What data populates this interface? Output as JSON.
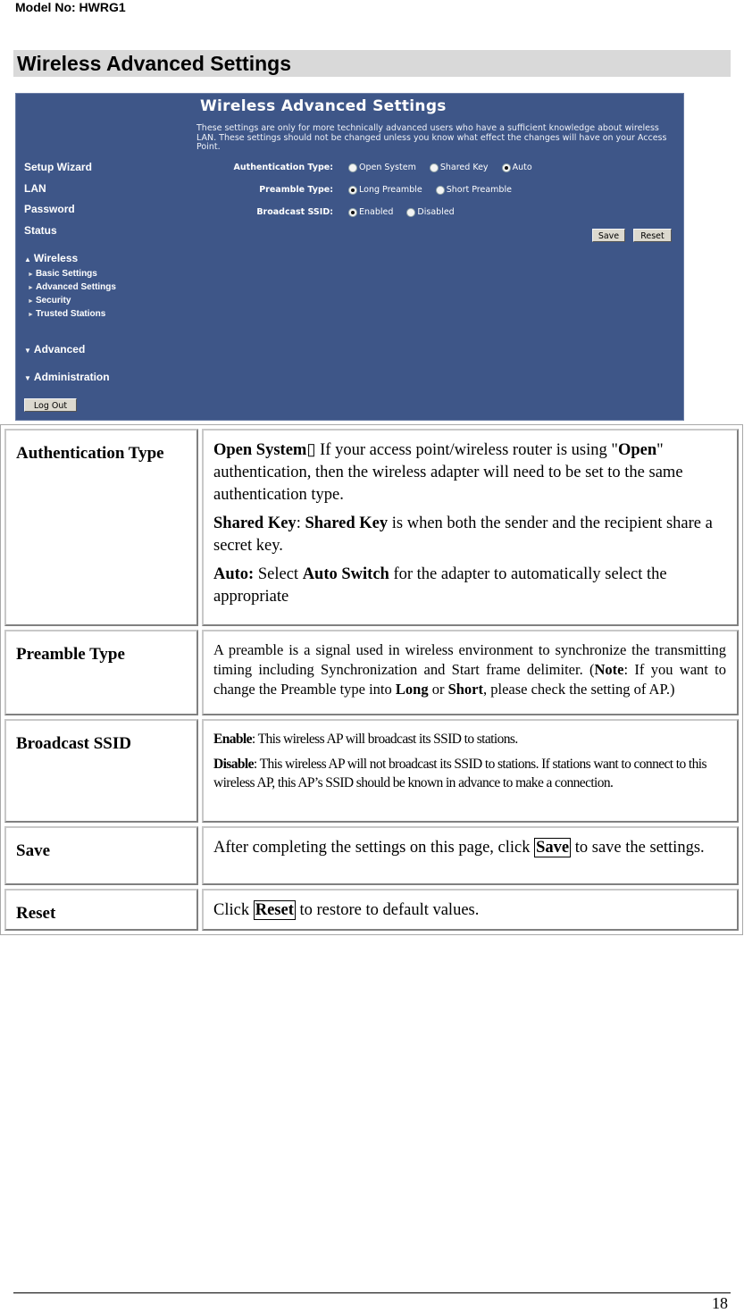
{
  "header": {
    "model": "Model No: HWRG1"
  },
  "section_title": "Wireless Advanced Settings",
  "router_ui": {
    "title": "Wireless Advanced Settings",
    "description": "These settings are only for more technically advanced users who have a sufficient knowledge about wireless LAN. These settings should not be changed unless you know what effect the changes will have on your Access Point.",
    "nav": {
      "setup_wizard": "Setup Wizard",
      "lan": "LAN",
      "password": "Password",
      "status": "Status",
      "wireless": "Wireless",
      "wireless_sub": [
        "Basic Settings",
        "Advanced Settings",
        "Security",
        "Trusted Stations"
      ],
      "advanced": "Advanced",
      "administration": "Administration",
      "logout": "Log Out"
    },
    "form": {
      "auth_label": "Authentication Type:",
      "auth_options": [
        "Open System",
        "Shared Key",
        "Auto"
      ],
      "auth_selected": "Auto",
      "preamble_label": "Preamble Type:",
      "preamble_options": [
        "Long Preamble",
        "Short Preamble"
      ],
      "preamble_selected": "Long Preamble",
      "ssid_label": "Broadcast SSID:",
      "ssid_options": [
        "Enabled",
        "Disabled"
      ],
      "ssid_selected": "Enabled",
      "save": "Save",
      "reset": "Reset"
    }
  },
  "table": {
    "auth": {
      "label": "Authentication Type",
      "open_term": "Open System",
      "open_glyph": "▯",
      "open_text_1": "  If your access point/wireless router is using \"",
      "open_term2": "Open",
      "open_text_2": "\" authentication, then the wireless adapter will need to be set to the same authentication type.",
      "shared_term": "Shared Key",
      "shared_colon": ": ",
      "shared_term2": "Shared Key",
      "shared_text": " is when both the sender and the recipient share a secret key.",
      "auto_term": "Auto:",
      "auto_text_1": " Select ",
      "auto_term2": "Auto Switch",
      "auto_text_2": " for the adapter to automatically select the appropriate"
    },
    "preamble": {
      "label": "Preamble Type",
      "text_1": "A preamble is a signal used in wireless environment to synchronize the transmitting timing including Synchronization and Start frame delimiter. (",
      "note": "Note",
      "text_2": ": If you want to change the Preamble type into ",
      "long": "Long",
      "text_3": " or ",
      "short": "Short",
      "text_4": ", please check the setting of AP.)"
    },
    "ssid": {
      "label": "Broadcast SSID",
      "enable_term": "Enable",
      "enable_text": ": This wireless AP will broadcast its SSID to stations.",
      "disable_term": "Disable",
      "disable_text": ": This wireless AP will not broadcast its SSID to stations. If stations want to connect to this wireless AP, this AP’s SSID should be known in advance to make a connection."
    },
    "save": {
      "label": "Save",
      "text_1": "After completing the settings on this page, click ",
      "button": "Save",
      "text_2": " to save the settings."
    },
    "reset": {
      "label": "Reset",
      "text_1": "Click ",
      "button": "Reset",
      "text_2": " to restore to default values."
    }
  },
  "footer": {
    "page_number": "18"
  }
}
